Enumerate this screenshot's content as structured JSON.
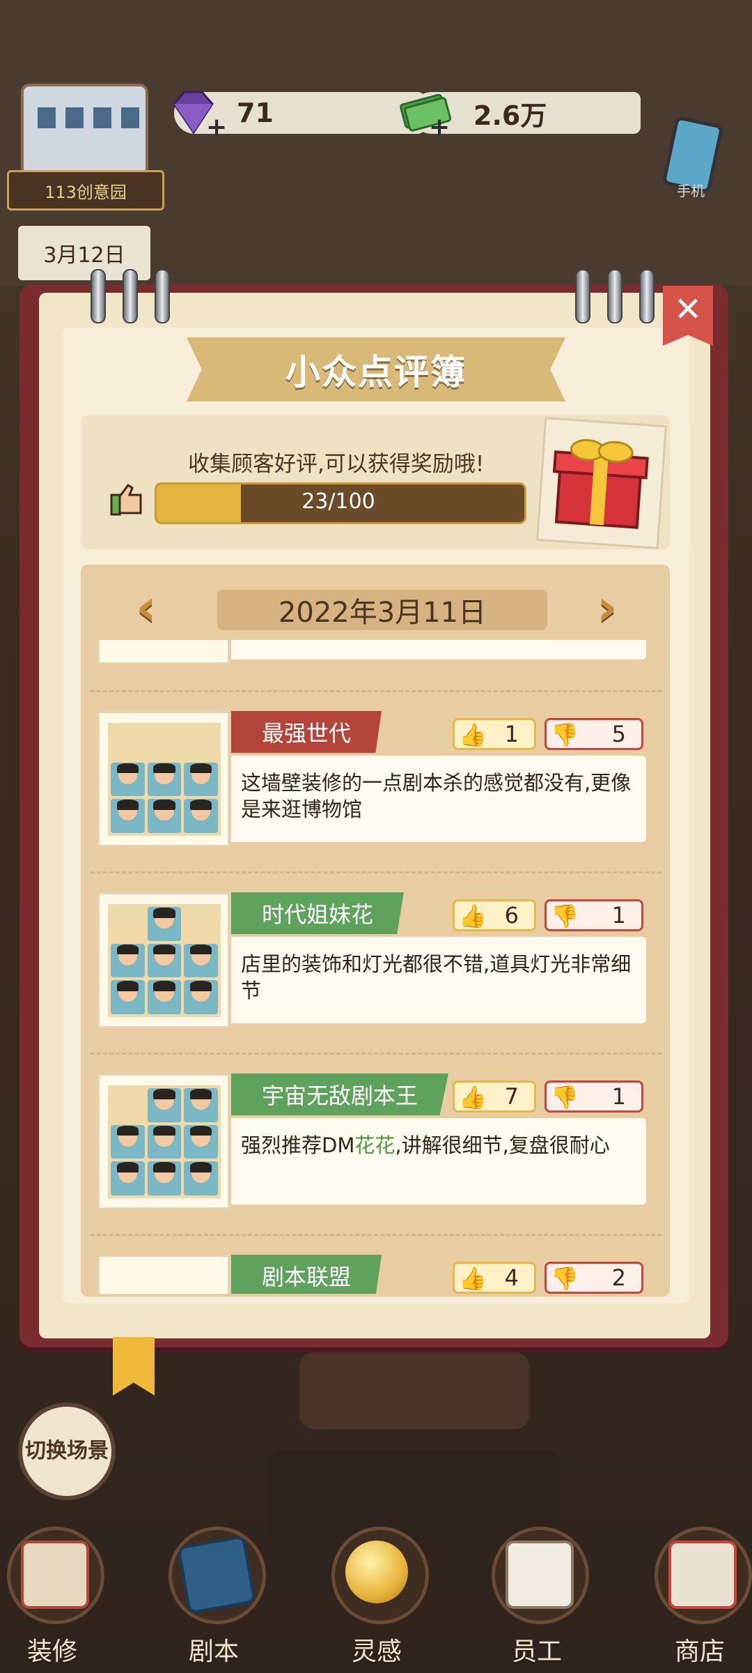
{
  "hud": {
    "location": "113创意园",
    "gems": "71",
    "cash": "2.6万",
    "plus": "+",
    "calendar_date": "3月12日",
    "phone_label": "手机"
  },
  "notebook": {
    "title": "小众点评簿",
    "close": "✕",
    "reward_text": "收集顾客好评,可以获得奖励哦!",
    "progress_text": "23/100",
    "progress_fraction": 0.23,
    "date": "2022年3月11日",
    "prev": "‹",
    "next": "›"
  },
  "reviews": [
    {
      "name": "最强世代",
      "color": "red",
      "likes": "1",
      "dislikes": "5",
      "comment": "这墙壁装修的一点剧本杀的感觉都没有,更像是来逛博物馆"
    },
    {
      "name": "时代姐妹花",
      "color": "green",
      "likes": "6",
      "dislikes": "1",
      "comment": "店里的装饰和灯光都很不错,道具灯光非常细节"
    },
    {
      "name": "宇宙无敌剧本王",
      "color": "green",
      "likes": "7",
      "dislikes": "1",
      "comment_pre": "强烈推荐DM",
      "comment_hl": "花花",
      "comment_post": ",讲解很细节,复盘很耐心"
    },
    {
      "name": "剧本联盟",
      "color": "green",
      "likes": "4",
      "dislikes": "2",
      "comment": ""
    }
  ],
  "bottom": {
    "switch_scene": "切换场景",
    "nav": [
      {
        "label": "装修",
        "icon": "house-icon"
      },
      {
        "label": "剧本",
        "icon": "script-book-icon"
      },
      {
        "label": "灵感",
        "icon": "lightbulb-icon"
      },
      {
        "label": "员工",
        "icon": "staff-badge-icon"
      },
      {
        "label": "商店",
        "icon": "shop-icon"
      }
    ]
  },
  "colors": {
    "accent_red": "#b4453b",
    "accent_green": "#5fa25e",
    "gold": "#e3b53f"
  }
}
